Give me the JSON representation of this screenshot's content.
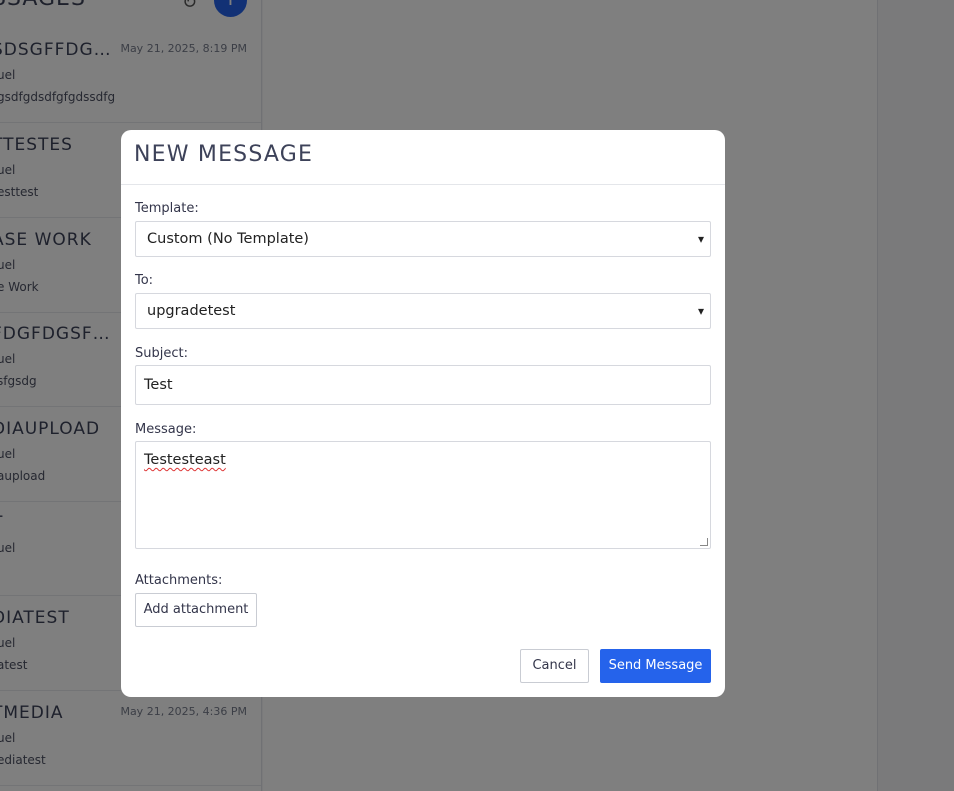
{
  "sidebar": {
    "title": "SSAGES",
    "refresh_icon": "refresh-icon",
    "add_icon": "plus-icon",
    "items": [
      {
        "subject": "SDSGFFDGD...",
        "date": "May 21, 2025, 8:19 PM",
        "sender": "uel",
        "preview": "gsdfgdsdfgfgdssdfg"
      },
      {
        "subject": "TTESTES",
        "date": "",
        "sender": "uel",
        "preview": "esttest"
      },
      {
        "subject": "ASE WORK",
        "date": "",
        "sender": "uel",
        "preview": "e Work"
      },
      {
        "subject": "FDGFDGSFD...",
        "date": "",
        "sender": "uel",
        "preview": "sfgsdg"
      },
      {
        "subject": "DIAUPLOAD",
        "date": "",
        "sender": "uel",
        "preview": "aupload"
      },
      {
        "subject": "T",
        "date": "",
        "sender": "uel",
        "preview": ""
      },
      {
        "subject": "DIATEST",
        "date": "",
        "sender": "uel",
        "preview": "atest"
      },
      {
        "subject": "TMEDIA",
        "date": "May 21, 2025, 4:36 PM",
        "sender": "uel",
        "preview": "ediatest"
      }
    ]
  },
  "modal": {
    "title": "NEW MESSAGE",
    "template_label": "Template:",
    "template_value": "Custom (No Template)",
    "to_label": "To:",
    "to_value": "upgradetest",
    "subject_label": "Subject:",
    "subject_value": "Test",
    "message_label": "Message:",
    "message_value": "Testesteast",
    "attachments_label": "Attachments:",
    "add_attachment_label": "Add attachment",
    "cancel_label": "Cancel",
    "send_label": "Send Message",
    "chevron": "⌄",
    "colors": {
      "primary": "#2563eb"
    }
  }
}
